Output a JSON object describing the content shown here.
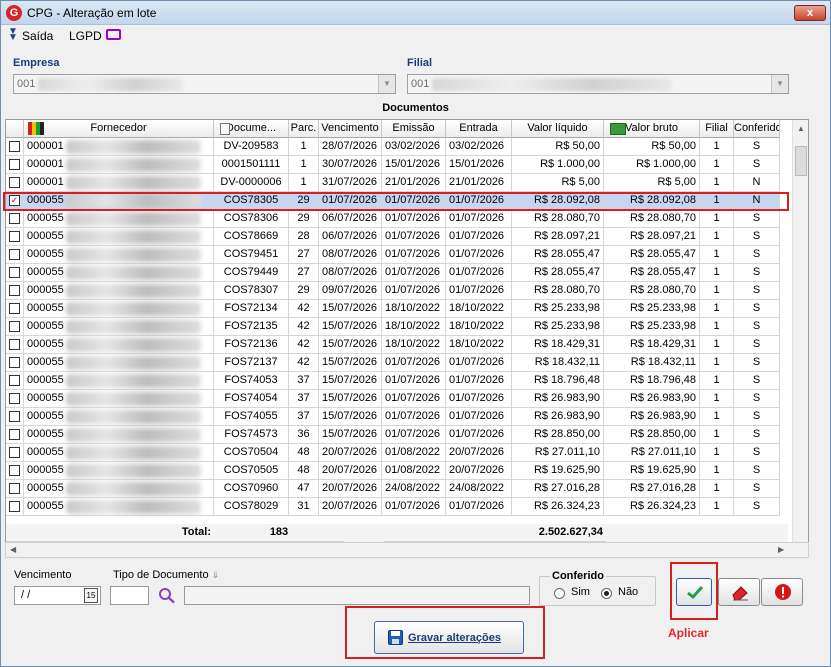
{
  "window": {
    "title": "CPG - Alteração em lote",
    "app_icon_letter": "G",
    "close_label": "x"
  },
  "menu": {
    "saida": "Saída",
    "lgpd": "LGPD"
  },
  "empresa": {
    "label": "Empresa",
    "value": "001"
  },
  "filial": {
    "label": "Filial",
    "value": "001"
  },
  "grid": {
    "caption": "Documentos",
    "columns": [
      "Fornecedor",
      "Docume...",
      "Parc.",
      "Vencimento",
      "Emissão",
      "Entrada",
      "Valor líquido",
      "Valor bruto",
      "Filial",
      "Conferido"
    ],
    "rows": [
      {
        "checked": false,
        "fornecedor": "000001",
        "documento": "DV-209583",
        "parc": "1",
        "vencimento": "28/07/2026",
        "emissao": "03/02/2026",
        "entrada": "03/02/2026",
        "liquido": "R$ 50,00",
        "bruto": "R$ 50,00",
        "filial": "1",
        "conferido": "S"
      },
      {
        "checked": false,
        "fornecedor": "000001",
        "documento": "0001501111",
        "parc": "1",
        "vencimento": "30/07/2026",
        "emissao": "15/01/2026",
        "entrada": "15/01/2026",
        "liquido": "R$ 1.000,00",
        "bruto": "R$ 1.000,00",
        "filial": "1",
        "conferido": "S"
      },
      {
        "checked": false,
        "fornecedor": "000001",
        "documento": "DV-0000006",
        "parc": "1",
        "vencimento": "31/07/2026",
        "emissao": "21/01/2026",
        "entrada": "21/01/2026",
        "liquido": "R$ 5,00",
        "bruto": "R$ 5,00",
        "filial": "1",
        "conferido": "N"
      },
      {
        "checked": true,
        "fornecedor": "000055",
        "documento": "COS78305",
        "parc": "29",
        "vencimento": "01/07/2026",
        "emissao": "01/07/2026",
        "entrada": "01/07/2026",
        "liquido": "R$ 28.092,08",
        "bruto": "R$ 28.092,08",
        "filial": "1",
        "conferido": "N"
      },
      {
        "checked": false,
        "fornecedor": "000055",
        "documento": "COS78306",
        "parc": "29",
        "vencimento": "06/07/2026",
        "emissao": "01/07/2026",
        "entrada": "01/07/2026",
        "liquido": "R$ 28.080,70",
        "bruto": "R$ 28.080,70",
        "filial": "1",
        "conferido": "S"
      },
      {
        "checked": false,
        "fornecedor": "000055",
        "documento": "COS78669",
        "parc": "28",
        "vencimento": "06/07/2026",
        "emissao": "01/07/2026",
        "entrada": "01/07/2026",
        "liquido": "R$ 28.097,21",
        "bruto": "R$ 28.097,21",
        "filial": "1",
        "conferido": "S"
      },
      {
        "checked": false,
        "fornecedor": "000055",
        "documento": "COS79451",
        "parc": "27",
        "vencimento": "08/07/2026",
        "emissao": "01/07/2026",
        "entrada": "01/07/2026",
        "liquido": "R$ 28.055,47",
        "bruto": "R$ 28.055,47",
        "filial": "1",
        "conferido": "S"
      },
      {
        "checked": false,
        "fornecedor": "000055",
        "documento": "COS79449",
        "parc": "27",
        "vencimento": "08/07/2026",
        "emissao": "01/07/2026",
        "entrada": "01/07/2026",
        "liquido": "R$ 28.055,47",
        "bruto": "R$ 28.055,47",
        "filial": "1",
        "conferido": "S"
      },
      {
        "checked": false,
        "fornecedor": "000055",
        "documento": "COS78307",
        "parc": "29",
        "vencimento": "09/07/2026",
        "emissao": "01/07/2026",
        "entrada": "01/07/2026",
        "liquido": "R$ 28.080,70",
        "bruto": "R$ 28.080,70",
        "filial": "1",
        "conferido": "S"
      },
      {
        "checked": false,
        "fornecedor": "000055",
        "documento": "FOS72134",
        "parc": "42",
        "vencimento": "15/07/2026",
        "emissao": "18/10/2022",
        "entrada": "18/10/2022",
        "liquido": "R$ 25.233,98",
        "bruto": "R$ 25.233,98",
        "filial": "1",
        "conferido": "S"
      },
      {
        "checked": false,
        "fornecedor": "000055",
        "documento": "FOS72135",
        "parc": "42",
        "vencimento": "15/07/2026",
        "emissao": "18/10/2022",
        "entrada": "18/10/2022",
        "liquido": "R$ 25.233,98",
        "bruto": "R$ 25.233,98",
        "filial": "1",
        "conferido": "S"
      },
      {
        "checked": false,
        "fornecedor": "000055",
        "documento": "FOS72136",
        "parc": "42",
        "vencimento": "15/07/2026",
        "emissao": "18/10/2022",
        "entrada": "18/10/2022",
        "liquido": "R$ 18.429,31",
        "bruto": "R$ 18.429,31",
        "filial": "1",
        "conferido": "S"
      },
      {
        "checked": false,
        "fornecedor": "000055",
        "documento": "FOS72137",
        "parc": "42",
        "vencimento": "15/07/2026",
        "emissao": "01/07/2026",
        "entrada": "01/07/2026",
        "liquido": "R$ 18.432,11",
        "bruto": "R$ 18.432,11",
        "filial": "1",
        "conferido": "S"
      },
      {
        "checked": false,
        "fornecedor": "000055",
        "documento": "FOS74053",
        "parc": "37",
        "vencimento": "15/07/2026",
        "emissao": "01/07/2026",
        "entrada": "01/07/2026",
        "liquido": "R$ 18.796,48",
        "bruto": "R$ 18.796,48",
        "filial": "1",
        "conferido": "S"
      },
      {
        "checked": false,
        "fornecedor": "000055",
        "documento": "FOS74054",
        "parc": "37",
        "vencimento": "15/07/2026",
        "emissao": "01/07/2026",
        "entrada": "01/07/2026",
        "liquido": "R$ 26.983,90",
        "bruto": "R$ 26.983,90",
        "filial": "1",
        "conferido": "S"
      },
      {
        "checked": false,
        "fornecedor": "000055",
        "documento": "FOS74055",
        "parc": "37",
        "vencimento": "15/07/2026",
        "emissao": "01/07/2026",
        "entrada": "01/07/2026",
        "liquido": "R$ 26.983,90",
        "bruto": "R$ 26.983,90",
        "filial": "1",
        "conferido": "S"
      },
      {
        "checked": false,
        "fornecedor": "000055",
        "documento": "FOS74573",
        "parc": "36",
        "vencimento": "15/07/2026",
        "emissao": "01/07/2026",
        "entrada": "01/07/2026",
        "liquido": "R$ 28.850,00",
        "bruto": "R$ 28.850,00",
        "filial": "1",
        "conferido": "S"
      },
      {
        "checked": false,
        "fornecedor": "000055",
        "documento": "COS70504",
        "parc": "48",
        "vencimento": "20/07/2026",
        "emissao": "01/08/2022",
        "entrada": "20/07/2026",
        "liquido": "R$ 27.011,10",
        "bruto": "R$ 27.011,10",
        "filial": "1",
        "conferido": "S"
      },
      {
        "checked": false,
        "fornecedor": "000055",
        "documento": "COS70505",
        "parc": "48",
        "vencimento": "20/07/2026",
        "emissao": "01/08/2022",
        "entrada": "20/07/2026",
        "liquido": "R$ 19.625,90",
        "bruto": "R$ 19.625,90",
        "filial": "1",
        "conferido": "S"
      },
      {
        "checked": false,
        "fornecedor": "000055",
        "documento": "COS70960",
        "parc": "47",
        "vencimento": "20/07/2026",
        "emissao": "24/08/2022",
        "entrada": "24/08/2022",
        "liquido": "R$ 27.016,28",
        "bruto": "R$ 27.016,28",
        "filial": "1",
        "conferido": "S"
      },
      {
        "checked": false,
        "fornecedor": "000055",
        "documento": "COS78029",
        "parc": "31",
        "vencimento": "20/07/2026",
        "emissao": "01/07/2026",
        "entrada": "01/07/2026",
        "liquido": "R$ 26.324,23",
        "bruto": "R$ 26.324,23",
        "filial": "1",
        "conferido": "S"
      }
    ],
    "total": {
      "label": "Total:",
      "count": "183",
      "amount": "2.502.627,34"
    }
  },
  "filters": {
    "vencimento_label": "Vencimento",
    "vencimento_value": "/ /",
    "calendar_label": "15",
    "tipo_documento_label": "Tipo de Documento",
    "conferido_label": "Conferido",
    "sim_label": "Sim",
    "nao_label": "Não",
    "conferido_selected": "Não"
  },
  "actions": {
    "aplicar_label": "Aplicar",
    "gravar_label": "Gravar alterações"
  },
  "colors": {
    "highlight_red": "#d42020",
    "selected_row": "#c7d6ef",
    "aplicar_text": "#e0242b"
  }
}
